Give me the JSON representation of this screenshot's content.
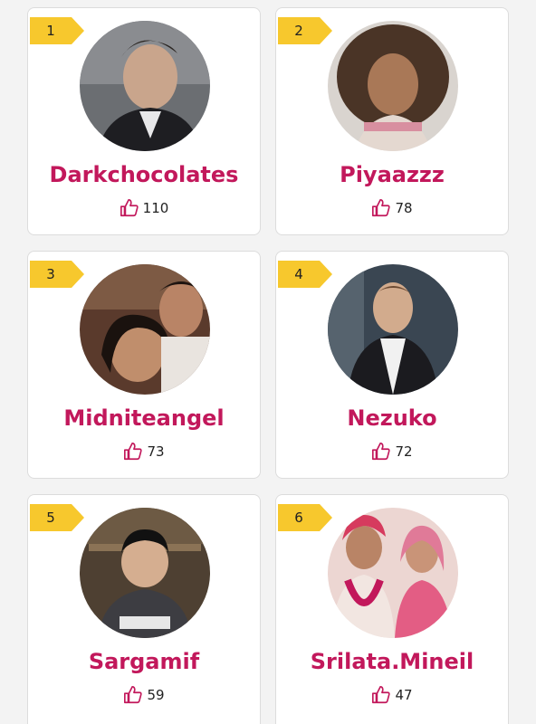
{
  "colors": {
    "rank_badge": "#f7c82d",
    "name_text": "#c2185b",
    "like_icon": "#c2185b"
  },
  "cards": [
    {
      "rank": "1",
      "name": "Darkchocolates",
      "likes": "110"
    },
    {
      "rank": "2",
      "name": "Piyaazzz",
      "likes": "78"
    },
    {
      "rank": "3",
      "name": "Midniteangel",
      "likes": "73"
    },
    {
      "rank": "4",
      "name": "Nezuko",
      "likes": "72"
    },
    {
      "rank": "5",
      "name": "Sargamif",
      "likes": "59"
    },
    {
      "rank": "6",
      "name": "Srilata.Mineil",
      "likes": "47"
    }
  ],
  "icons": {
    "like": "thumbs-up-icon",
    "rank": "rank-badge"
  }
}
